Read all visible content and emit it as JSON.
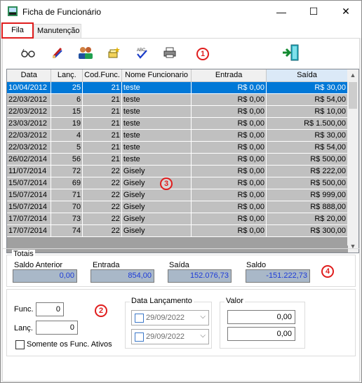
{
  "window": {
    "title": "Ficha de Funcionário",
    "minimize": "—",
    "maximize": "☐",
    "close": "✕"
  },
  "tabs": [
    {
      "label": "Fila"
    },
    {
      "label": "Manutenção"
    }
  ],
  "markers": {
    "toolbar": "1",
    "filters": "2",
    "grid": "3",
    "totals": "4"
  },
  "grid": {
    "columns": [
      "Data",
      "Lanç.",
      "Cod.Func.",
      "Nome Funcionario",
      "Entrada",
      "Saída"
    ],
    "rows": [
      [
        "10/04/2012",
        "25",
        "21",
        "teste",
        "R$ 0,00",
        "R$ 30,00"
      ],
      [
        "22/03/2012",
        "6",
        "21",
        "teste",
        "R$ 0,00",
        "R$ 54,00"
      ],
      [
        "22/03/2012",
        "15",
        "21",
        "teste",
        "R$ 0,00",
        "R$ 10,00"
      ],
      [
        "23/03/2012",
        "19",
        "21",
        "teste",
        "R$ 0,00",
        "R$ 1.500,00"
      ],
      [
        "22/03/2012",
        "4",
        "21",
        "teste",
        "R$ 0,00",
        "R$ 30,00"
      ],
      [
        "22/03/2012",
        "5",
        "21",
        "teste",
        "R$ 0,00",
        "R$ 54,00"
      ],
      [
        "26/02/2014",
        "56",
        "21",
        "teste",
        "R$ 0,00",
        "R$ 500,00"
      ],
      [
        "11/07/2014",
        "72",
        "22",
        "Gisely",
        "R$ 0,00",
        "R$ 222,00"
      ],
      [
        "15/07/2014",
        "69",
        "22",
        "Gisely",
        "R$ 0,00",
        "R$ 500,00"
      ],
      [
        "15/07/2014",
        "71",
        "22",
        "Gisely",
        "R$ 0,00",
        "R$ 999,00"
      ],
      [
        "15/07/2014",
        "70",
        "22",
        "Gisely",
        "R$ 0,00",
        "R$ 888,00"
      ],
      [
        "17/07/2014",
        "73",
        "22",
        "Gisely",
        "R$ 0,00",
        "R$ 20,00"
      ],
      [
        "17/07/2014",
        "74",
        "22",
        "Gisely",
        "R$ 0,00",
        "R$ 300,00"
      ]
    ]
  },
  "totais": {
    "legend": "Totais",
    "saldo_anterior_label": "Saldo Anterior",
    "saldo_anterior": "0,00",
    "entrada_label": "Entrada",
    "entrada": "854,00",
    "saida_label": "Saída",
    "saida": "152.076,73",
    "saldo_label": "Saldo",
    "saldo": "-151.222,73"
  },
  "filters": {
    "func_label": "Func.",
    "func_value": "0",
    "lanc_label": "Lanç.",
    "lanc_value": "0",
    "somente_label": "Somente os Func. Ativos",
    "data_legend": "Data Lançamento",
    "date_from": "29/09/2022",
    "date_to": "29/09/2022",
    "valor_legend": "Valor",
    "valor_from": "0,00",
    "valor_to": "0,00"
  },
  "colors": {
    "accent": "#0078d7",
    "marker": "#e01d1d",
    "value_text": "#1d3bd8"
  }
}
